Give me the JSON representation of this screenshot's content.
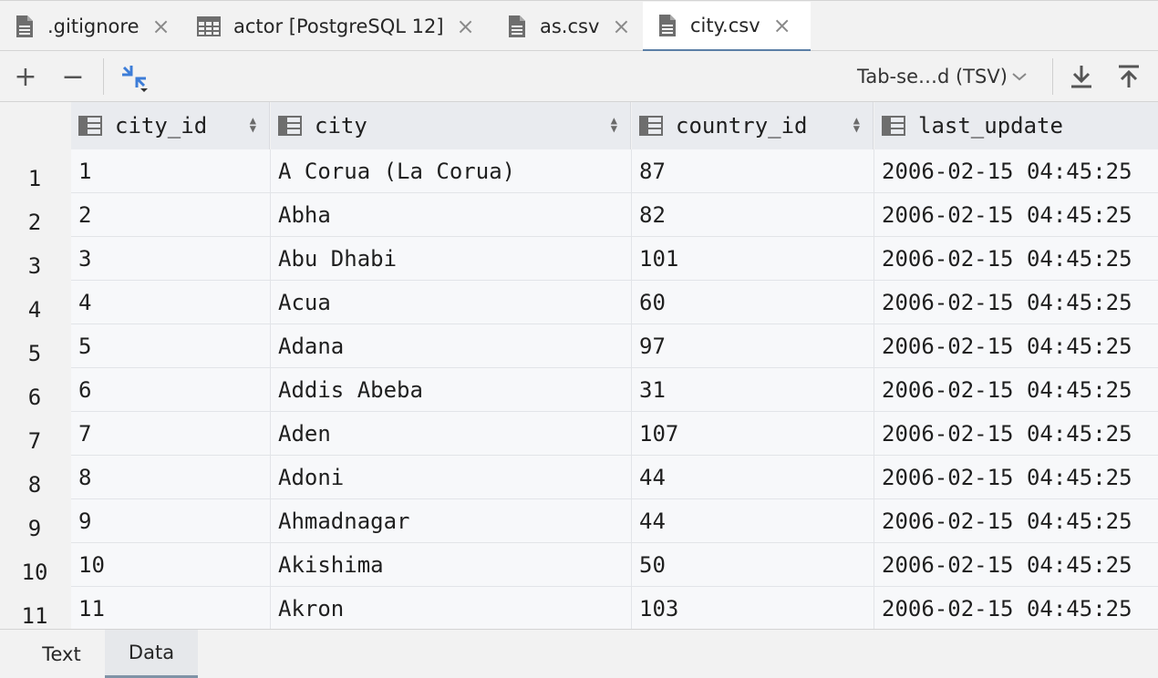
{
  "tabs": [
    {
      "label": ".gitignore",
      "icon": "file-icon"
    },
    {
      "label": "actor [PostgreSQL 12]",
      "icon": "table-icon"
    },
    {
      "label": "as.csv",
      "icon": "file-icon"
    },
    {
      "label": "city.csv",
      "icon": "file-icon",
      "active": true
    }
  ],
  "toolbar": {
    "add_label": "+",
    "remove_label": "−",
    "format_label": "Tab-se…d (TSV)"
  },
  "table": {
    "columns": [
      "city_id",
      "city",
      "country_id",
      "last_update"
    ],
    "rows": [
      {
        "num": "1",
        "cells": [
          "1",
          "A Corua (La Corua)",
          "87",
          "2006-02-15 04:45:25"
        ]
      },
      {
        "num": "2",
        "cells": [
          "2",
          "Abha",
          "82",
          "2006-02-15 04:45:25"
        ]
      },
      {
        "num": "3",
        "cells": [
          "3",
          "Abu Dhabi",
          "101",
          "2006-02-15 04:45:25"
        ]
      },
      {
        "num": "4",
        "cells": [
          "4",
          "Acua",
          "60",
          "2006-02-15 04:45:25"
        ]
      },
      {
        "num": "5",
        "cells": [
          "5",
          "Adana",
          "97",
          "2006-02-15 04:45:25"
        ]
      },
      {
        "num": "6",
        "cells": [
          "6",
          "Addis Abeba",
          "31",
          "2006-02-15 04:45:25"
        ]
      },
      {
        "num": "7",
        "cells": [
          "7",
          "Aden",
          "107",
          "2006-02-15 04:45:25"
        ]
      },
      {
        "num": "8",
        "cells": [
          "8",
          "Adoni",
          "44",
          "2006-02-15 04:45:25"
        ]
      },
      {
        "num": "9",
        "cells": [
          "9",
          "Ahmadnagar",
          "44",
          "2006-02-15 04:45:25"
        ]
      },
      {
        "num": "10",
        "cells": [
          "10",
          "Akishima",
          "50",
          "2006-02-15 04:45:25"
        ]
      },
      {
        "num": "11",
        "cells": [
          "11",
          "Akron",
          "103",
          "2006-02-15 04:45:25"
        ]
      }
    ]
  },
  "bottom_tabs": [
    {
      "label": "Text"
    },
    {
      "label": "Data",
      "active": true
    }
  ],
  "colors": {
    "accent": "#3d7dd8",
    "active_tab_border": "#5b7fa6"
  }
}
